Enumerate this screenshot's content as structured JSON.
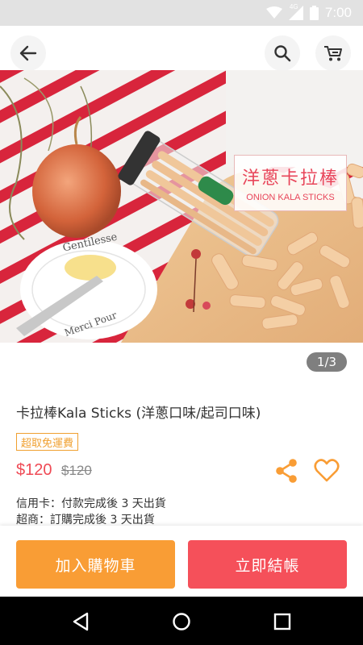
{
  "status_bar": {
    "time": "7:00",
    "network": "4G"
  },
  "hero": {
    "tag_title": "洋蔥卡拉棒",
    "tag_subtitle": "ONION KALA STICKS",
    "plate_text_1": "Gentilesse",
    "plate_text_2": "Merci Pour",
    "pager": "1/3"
  },
  "product": {
    "title": "卡拉棒Kala Sticks (洋蔥口味/起司口味)",
    "promo_tag": "超取免運費",
    "price": "$120",
    "original_price": "$120",
    "shipping_card": "信用卡：付款完成後 3 天出貨",
    "shipping_store": "超商：訂購完成後 3 天出貨"
  },
  "actions": {
    "add_to_cart": "加入購物車",
    "checkout": "立即結帳"
  },
  "colors": {
    "accent_orange": "#f99d35",
    "accent_red": "#f5505a",
    "price_red": "#ef4a55"
  },
  "icons": {
    "back": "arrow-left-icon",
    "search": "search-icon",
    "cart": "cart-icon",
    "share": "share-icon",
    "favorite": "heart-icon",
    "nav_back": "triangle-back-icon",
    "nav_home": "circle-home-icon",
    "nav_recents": "square-recents-icon"
  }
}
